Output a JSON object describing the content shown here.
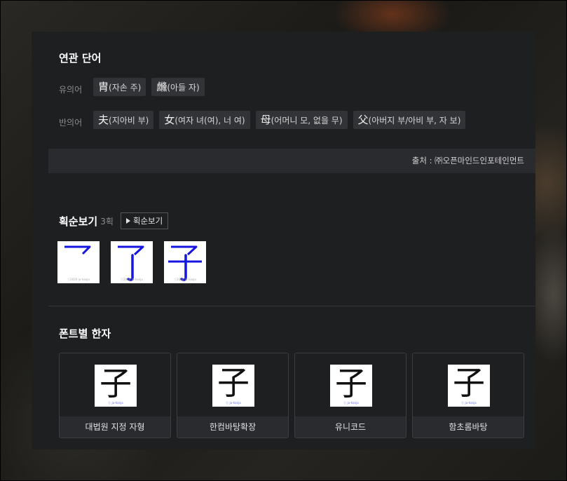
{
  "related": {
    "title": "연관 단어",
    "synonym_label": "유의어",
    "synonyms": [
      {
        "han": "胄",
        "text": "(자손 주)"
      },
      {
        "han": "虪",
        "text": "(아들 자)"
      }
    ],
    "antonym_label": "반의어",
    "antonyms": [
      {
        "han": "夫",
        "text": "(지아비 부)"
      },
      {
        "han": "女",
        "text": "(여자 녀(여), 너 여)"
      },
      {
        "han": "母",
        "text": "(어머니 모, 없을 무)"
      },
      {
        "han": "父",
        "text": "(아버지 부/아비 부, 자 보)"
      }
    ],
    "source": "출처 : ㈜오픈마인드인포테인먼트"
  },
  "stroke": {
    "title": "획순보기",
    "count": "3획",
    "play_label": "획순보기",
    "copyright": "ⓒ2020 jo-hanja",
    "stroke_color": "#1515e0"
  },
  "fonts": {
    "title": "폰트별 한자",
    "character": "子",
    "watermark": "ⓒ jo-hanja",
    "items": [
      {
        "name": "대법원 지정 자형"
      },
      {
        "name": "한컴바탕확장"
      },
      {
        "name": "유니코드"
      },
      {
        "name": "함초롬바탕"
      }
    ]
  }
}
